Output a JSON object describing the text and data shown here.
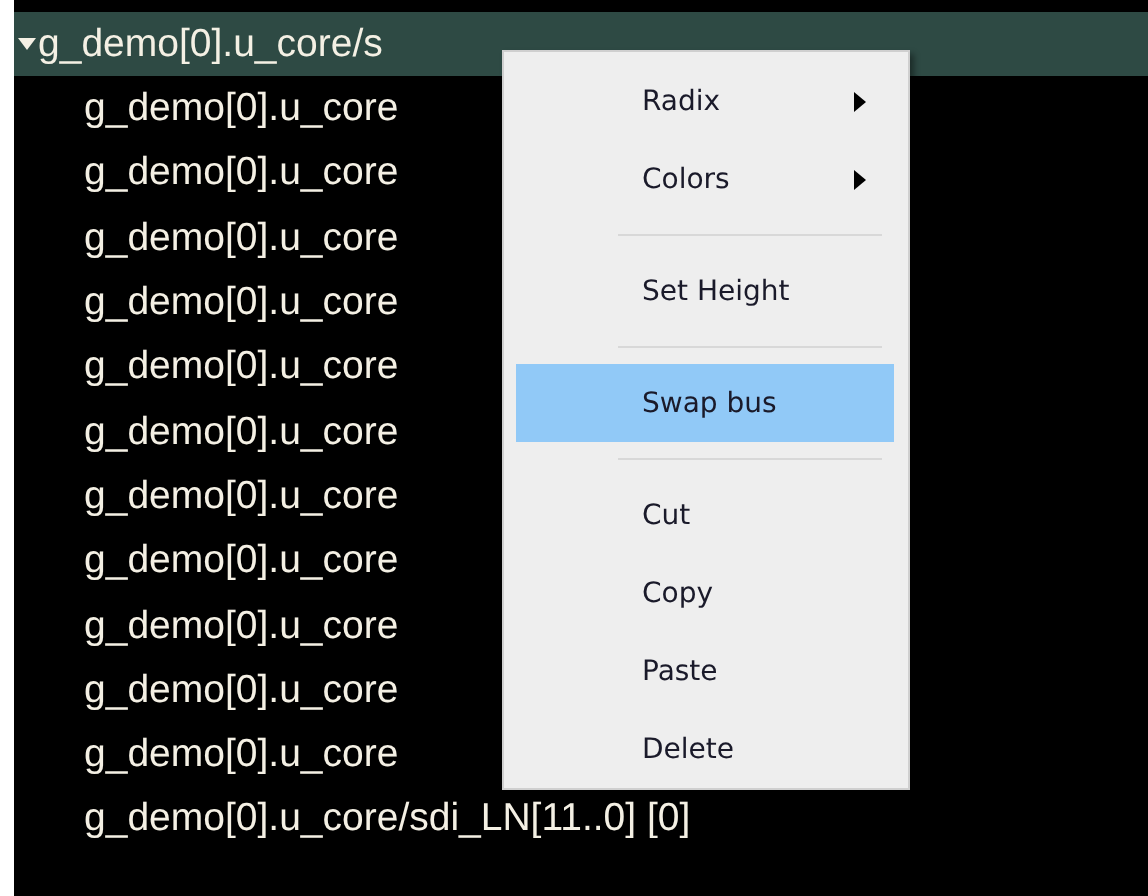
{
  "signal_tree": {
    "label": "g_demo[0].u_core/s",
    "expanded": true,
    "selected": true,
    "children": [
      {
        "label": "g_demo[0].u_core"
      },
      {
        "label": "g_demo[0].u_core"
      },
      {
        "label": "g_demo[0].u_core"
      },
      {
        "label": "g_demo[0].u_core"
      },
      {
        "label": "g_demo[0].u_core"
      },
      {
        "label": "g_demo[0].u_core"
      },
      {
        "label": "g_demo[0].u_core"
      },
      {
        "label": "g_demo[0].u_core"
      },
      {
        "label": "g_demo[0].u_core"
      },
      {
        "label": "g_demo[0].u_core"
      },
      {
        "label": "g_demo[0].u_core"
      },
      {
        "label": "g_demo[0].u_core/sdi_LN[11..0] [0]"
      }
    ]
  },
  "context_menu": {
    "items": [
      {
        "kind": "submenu",
        "label": "Radix",
        "selected": false
      },
      {
        "kind": "submenu",
        "label": "Colors",
        "selected": false
      },
      {
        "kind": "separator"
      },
      {
        "kind": "item",
        "label": "Set Height",
        "selected": false
      },
      {
        "kind": "separator"
      },
      {
        "kind": "item",
        "label": "Swap bus",
        "selected": true
      },
      {
        "kind": "separator"
      },
      {
        "kind": "item",
        "label": "Cut",
        "selected": false
      },
      {
        "kind": "item",
        "label": "Copy",
        "selected": false
      },
      {
        "kind": "item",
        "label": "Paste",
        "selected": false
      },
      {
        "kind": "item",
        "label": "Delete",
        "selected": false
      }
    ]
  }
}
